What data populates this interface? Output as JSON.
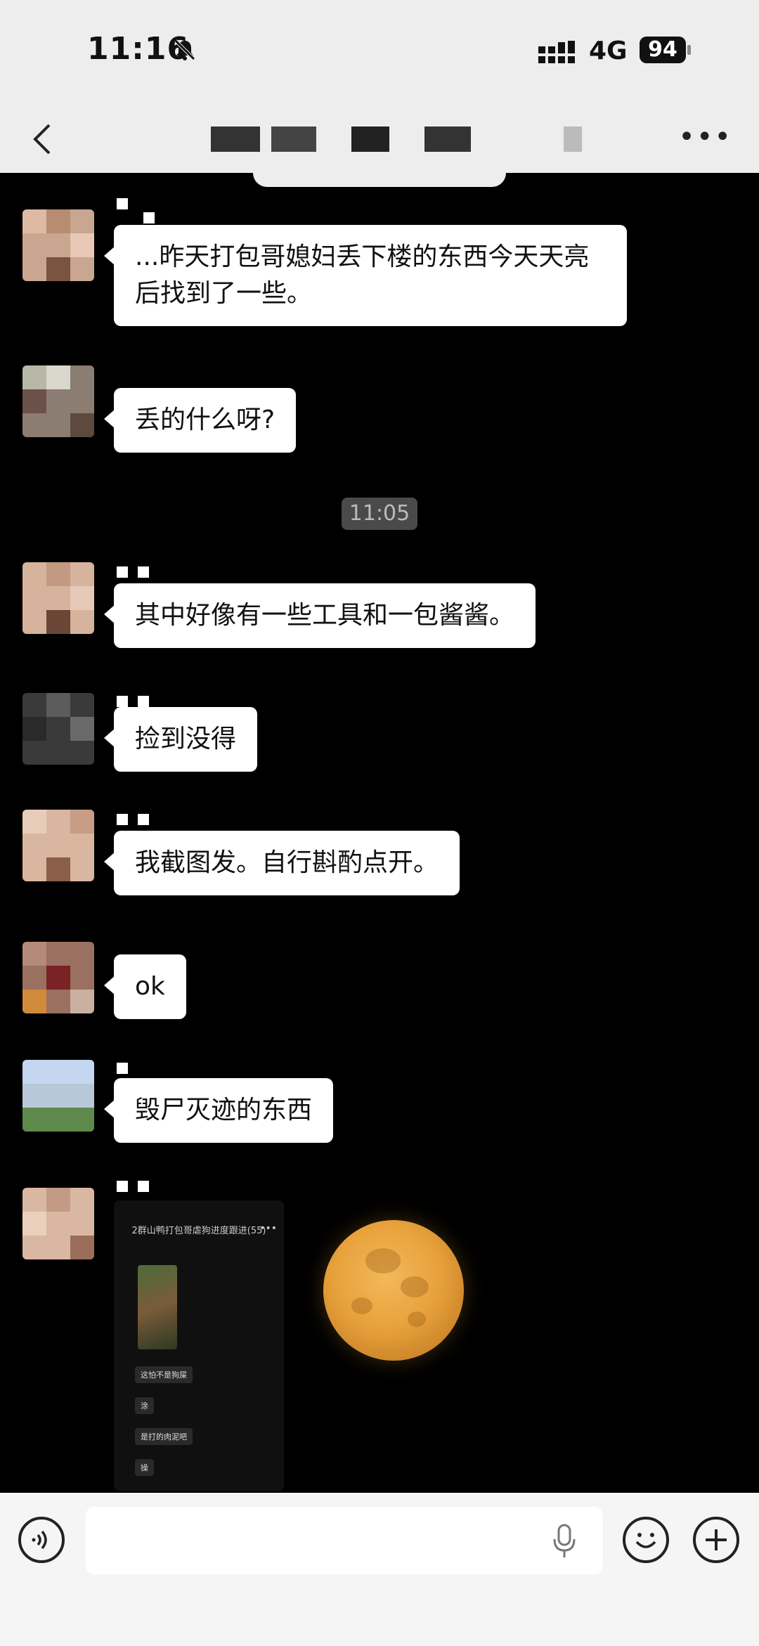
{
  "status_bar": {
    "time": "11:16",
    "network": "4G",
    "battery": "94"
  },
  "messages": [
    {
      "text": "...昨天打包哥媳妇丢下楼的东西今天天亮后找到了一些。"
    },
    {
      "text": "丢的什么呀?"
    },
    {
      "text": "其中好像有一些工具和一包酱酱。"
    },
    {
      "text": "捡到没得"
    },
    {
      "text": "我截图发。自行斟酌点开。"
    },
    {
      "text": "ok"
    },
    {
      "text": "毁尸灭迹的东西"
    }
  ],
  "timestamp": "11:05",
  "image_message": {
    "header": "2群山鸭打包哥虐狗进度跟进(55)",
    "lines": [
      "这怕不是狗屎",
      "涂",
      "是打的肉泥吧",
      "操"
    ]
  },
  "icons": {
    "back": "chevron-left-icon",
    "more": "more-icon",
    "voice": "voice-icon",
    "mic": "mic-icon",
    "emoji": "emoji-icon",
    "plus": "plus-icon"
  }
}
